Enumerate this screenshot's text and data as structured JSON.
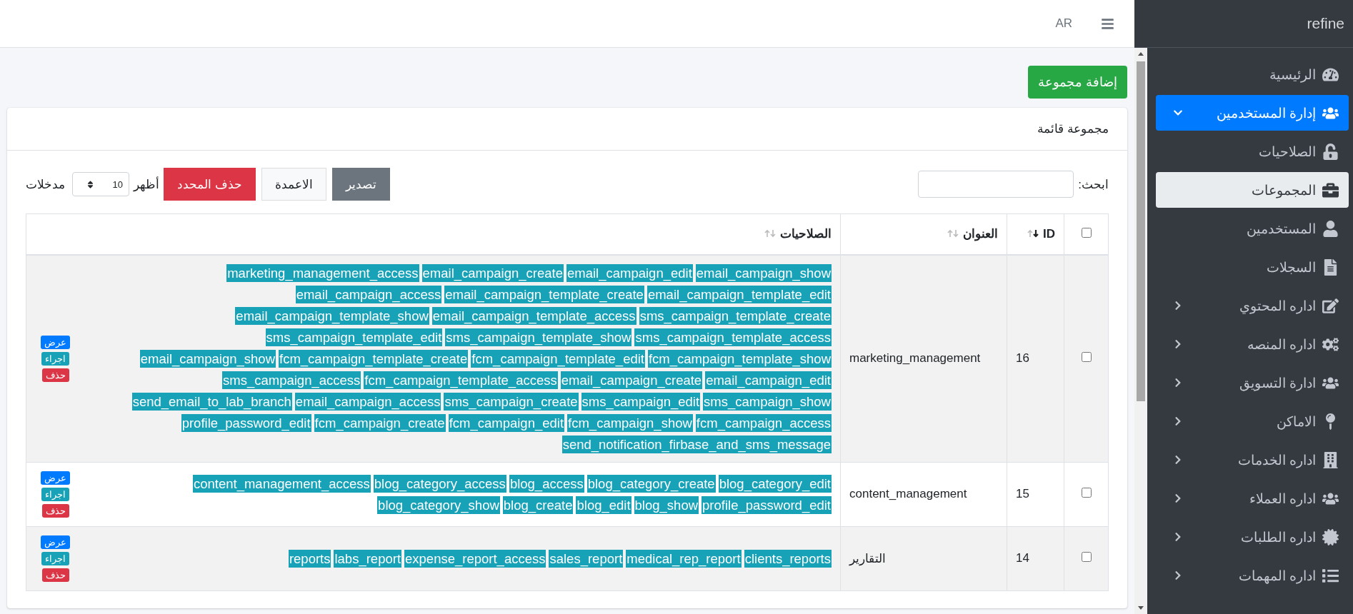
{
  "sidebar": {
    "brand": "refine",
    "items": [
      {
        "label": "الرئيسية",
        "selected": false
      },
      {
        "label": "إدارة المستخدمين",
        "selected": false,
        "expanded": true,
        "children": [
          {
            "label": "الصلاحيات",
            "selected": false
          },
          {
            "label": "المجموعات",
            "selected": true
          },
          {
            "label": "المستخدمين",
            "selected": false
          },
          {
            "label": "السجلات",
            "selected": false
          }
        ]
      },
      {
        "label": "اداره المحتوي",
        "selected": false,
        "expanded": false
      },
      {
        "label": "اداره المنصه",
        "selected": false,
        "expanded": false
      },
      {
        "label": "ادارة التسويق",
        "selected": false,
        "expanded": false
      },
      {
        "label": "الاماكن",
        "selected": false,
        "expanded": false
      },
      {
        "label": "اداره الخدمات",
        "selected": false,
        "expanded": false
      },
      {
        "label": "اداره العملاء",
        "selected": false,
        "expanded": false
      },
      {
        "label": "اداره الطلبات",
        "selected": false,
        "expanded": false
      },
      {
        "label": "اداره المهمات",
        "selected": false,
        "expanded": false
      }
    ]
  },
  "header": {
    "language": "AR"
  },
  "page": {
    "add_button": "إضافة مجموعة",
    "card_title": "مجموعة قائمة",
    "toolbar": {
      "search_label": "ابحث:",
      "buttons": [
        {
          "label": "تصدير",
          "kind": "secondary"
        },
        {
          "label": "الاعمدة",
          "kind": "light"
        },
        {
          "label": "حذف المحدد",
          "kind": "danger"
        }
      ],
      "show_label": "أظهر",
      "page_size": "10",
      "entries_label": "مدخلات"
    },
    "table": {
      "header_checkbox": {
        "checked": false
      },
      "columns": [
        {
          "label": "ID",
          "sorted": true
        },
        {
          "label": "العنوان",
          "sorted": false
        },
        {
          "label": "الصلاحيات",
          "sorted": false
        }
      ],
      "rows": [
        {
          "checked": false,
          "id": "16",
          "title": "marketing_management",
          "permissions": [
            "email_campaign_show",
            "email_campaign_edit",
            "email_campaign_create",
            "marketing_management_access",
            "email_campaign_template_edit",
            "email_campaign_template_create",
            "email_campaign_access",
            "sms_campaign_template_create",
            "email_campaign_template_access",
            "email_campaign_template_show",
            "sms_campaign_template_access",
            "sms_campaign_template_show",
            "sms_campaign_template_edit",
            "fcm_campaign_template_show",
            "fcm_campaign_template_edit",
            "fcm_campaign_template_create",
            "email_campaign_show",
            "email_campaign_edit",
            "email_campaign_create",
            "fcm_campaign_template_access",
            "sms_campaign_access",
            "sms_campaign_show",
            "sms_campaign_edit",
            "sms_campaign_create",
            "email_campaign_access",
            "send_email_to_lab_branch",
            "fcm_campaign_access",
            "fcm_campaign_show",
            "fcm_campaign_edit",
            "fcm_campaign_create",
            "profile_password_edit",
            "send_notification_firbase_and_sms_message"
          ],
          "actions": [
            {
              "label": "عرض",
              "kind": "primary"
            },
            {
              "label": "اجراء",
              "kind": "info"
            },
            {
              "label": "حذف",
              "kind": "danger"
            }
          ]
        },
        {
          "checked": false,
          "id": "15",
          "title": "content_management",
          "permissions": [
            "blog_category_edit",
            "blog_category_create",
            "blog_access",
            "blog_category_access",
            "content_management_access",
            "profile_password_edit",
            "blog_show",
            "blog_edit",
            "blog_create",
            "blog_category_show"
          ],
          "actions": [
            {
              "label": "عرض",
              "kind": "primary"
            },
            {
              "label": "اجراء",
              "kind": "info"
            },
            {
              "label": "حذف",
              "kind": "danger"
            }
          ]
        },
        {
          "checked": false,
          "id": "14",
          "title": "التقارير",
          "permissions": [
            "clients_reports",
            "medical_rep_report",
            "sales_report",
            "expense_report_access",
            "labs_report",
            "reports"
          ],
          "actions": [
            {
              "label": "عرض",
              "kind": "primary"
            },
            {
              "label": "اجراء",
              "kind": "info"
            },
            {
              "label": "حذف",
              "kind": "danger"
            }
          ]
        }
      ]
    }
  }
}
